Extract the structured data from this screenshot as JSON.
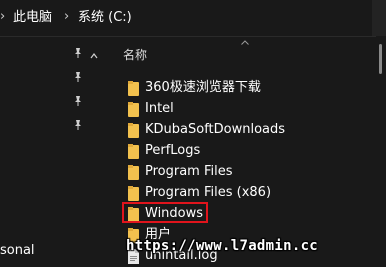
{
  "breadcrumb": {
    "items": [
      "此电脑",
      "系统 (C:)"
    ],
    "separator": "›"
  },
  "navpane": {
    "bottom_label": "sonal"
  },
  "filelist": {
    "column_header": "名称",
    "items": [
      {
        "name": "360极速浏览器下载",
        "type": "folder"
      },
      {
        "name": "Intel",
        "type": "folder"
      },
      {
        "name": "KDubaSoftDownloads",
        "type": "folder"
      },
      {
        "name": "PerfLogs",
        "type": "folder"
      },
      {
        "name": "Program Files",
        "type": "folder"
      },
      {
        "name": "Program Files (x86)",
        "type": "folder"
      },
      {
        "name": "Windows",
        "type": "folder",
        "highlighted": true
      },
      {
        "name": "用户",
        "type": "folder"
      },
      {
        "name": "unintall.log",
        "type": "file"
      }
    ]
  },
  "watermark": "https://www.l7admin.cc",
  "colors": {
    "background": "#191919",
    "folder": "#f2c14e",
    "highlight": "#e0141c"
  }
}
